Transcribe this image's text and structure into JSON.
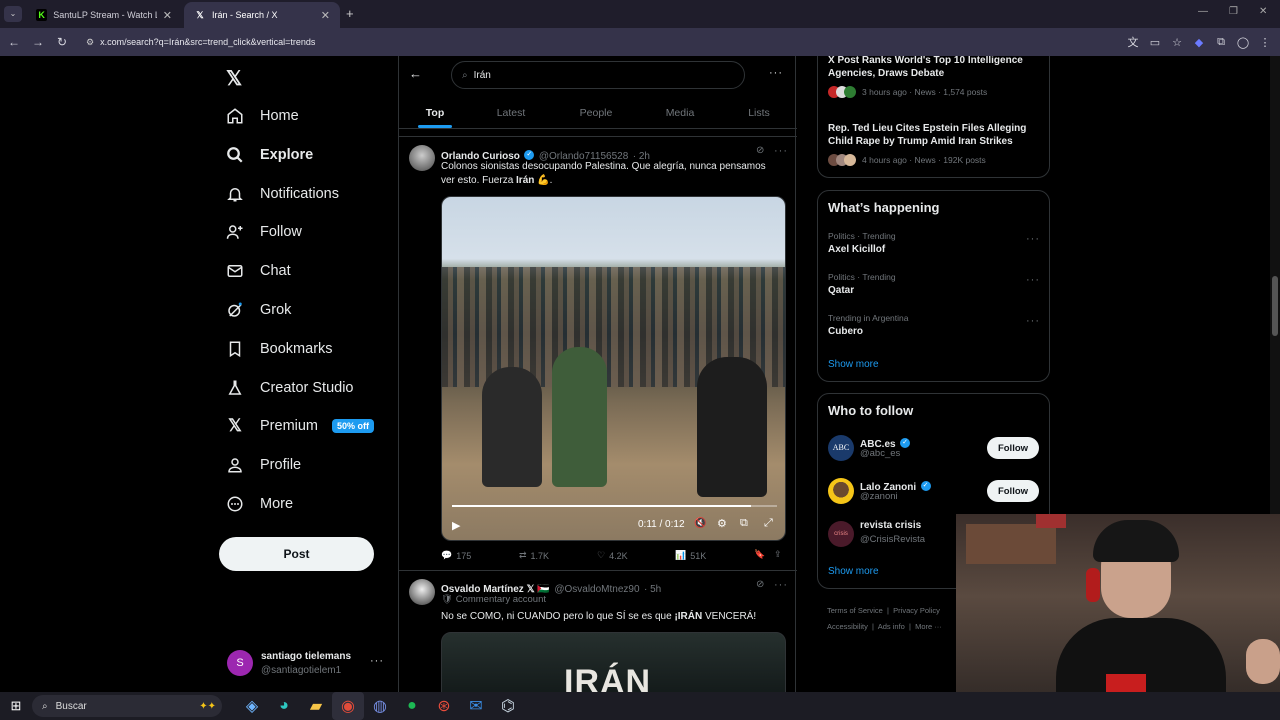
{
  "browser": {
    "tabs": [
      {
        "title": "SantuLP Stream - Watch Live o"
      },
      {
        "title": "Irán - Search / X"
      }
    ],
    "url": "x.com/search?q=Irán&src=trend_click&vertical=trends"
  },
  "sidebar": {
    "items": [
      {
        "label": "Home",
        "icon": "home-icon"
      },
      {
        "label": "Explore",
        "icon": "search-icon"
      },
      {
        "label": "Notifications",
        "icon": "bell-icon"
      },
      {
        "label": "Follow",
        "icon": "add-person-icon"
      },
      {
        "label": "Chat",
        "icon": "mail-icon"
      },
      {
        "label": "Grok",
        "icon": "grok-icon"
      },
      {
        "label": "Bookmarks",
        "icon": "bookmark-icon"
      },
      {
        "label": "Creator Studio",
        "icon": "flask-icon"
      },
      {
        "label": "Premium",
        "icon": "x-icon"
      },
      {
        "label": "Profile",
        "icon": "person-icon"
      },
      {
        "label": "More",
        "icon": "more-circle-icon"
      }
    ],
    "premium_badge": "50% off",
    "post_label": "Post",
    "account": {
      "name": "santiago tielemans",
      "handle": "@santiagotielem1",
      "initial": "S"
    }
  },
  "search": {
    "query": "Irán",
    "tabs": [
      "Top",
      "Latest",
      "People",
      "Media",
      "Lists"
    ]
  },
  "tweets": [
    {
      "name": "Orlando Curioso",
      "handle": "@Orlando71156528",
      "time": "· 2h",
      "text_before": "Colonos sionistas desocupando Palestina. Que alegría, nunca pensamos ver esto. Fuerza ",
      "text_bold": "Irán",
      "text_after": " 💪.",
      "video_time": "0:11 / 0:12",
      "video_progress": 0.92,
      "replies": "175",
      "reposts": "1.7K",
      "likes": "4.2K",
      "views": "51K"
    },
    {
      "name": "Osvaldo Martínez 𝕏 🇵🇸",
      "handle": "@OsvaldoMtnez90",
      "time": "· 5h",
      "label": "Commentary account",
      "text_before": "No se COMO, ni CUANDO pero lo que SÍ se es que ",
      "text_bold": "¡IRÁN",
      "text_after": " VENCERÁ!",
      "image_text": "IRÁN"
    }
  ],
  "news": [
    {
      "title": "X Post Ranks World's Top 10 Intelligence Agencies, Draws Debate",
      "meta": "3 hours ago · News · 1,574 posts"
    },
    {
      "title": "Rep. Ted Lieu Cites Epstein Files Alleging Child Rape by Trump Amid Iran Strikes",
      "meta": "4 hours ago · News · 192K posts"
    }
  ],
  "happening": {
    "title": "What’s happening",
    "items": [
      {
        "context": "Politics · Trending",
        "topic": "Axel Kicillof"
      },
      {
        "context": "Politics · Trending",
        "topic": "Qatar"
      },
      {
        "context": "Trending in Argentina",
        "topic": "Cubero"
      }
    ],
    "show_more": "Show more"
  },
  "who_to_follow": {
    "title": "Who to follow",
    "items": [
      {
        "name": "ABC.es",
        "handle": "@abc_es",
        "avatar_text": "ABC",
        "verified": true,
        "button": "Follow"
      },
      {
        "name": "Lalo Zanoni",
        "handle": "@zanoni",
        "avatar_text": "",
        "verified": true,
        "button": "Follow"
      },
      {
        "name": "revista crisis",
        "handle": "@CrisisRevista",
        "avatar_text": "crisis",
        "verified": false,
        "button": ""
      }
    ],
    "show_more": "Show more"
  },
  "footer": {
    "links": [
      "Terms of Service",
      "Privacy Policy",
      "Accessibility",
      "Ads info",
      "More ···"
    ]
  },
  "taskbar": {
    "search_label": "Buscar"
  }
}
